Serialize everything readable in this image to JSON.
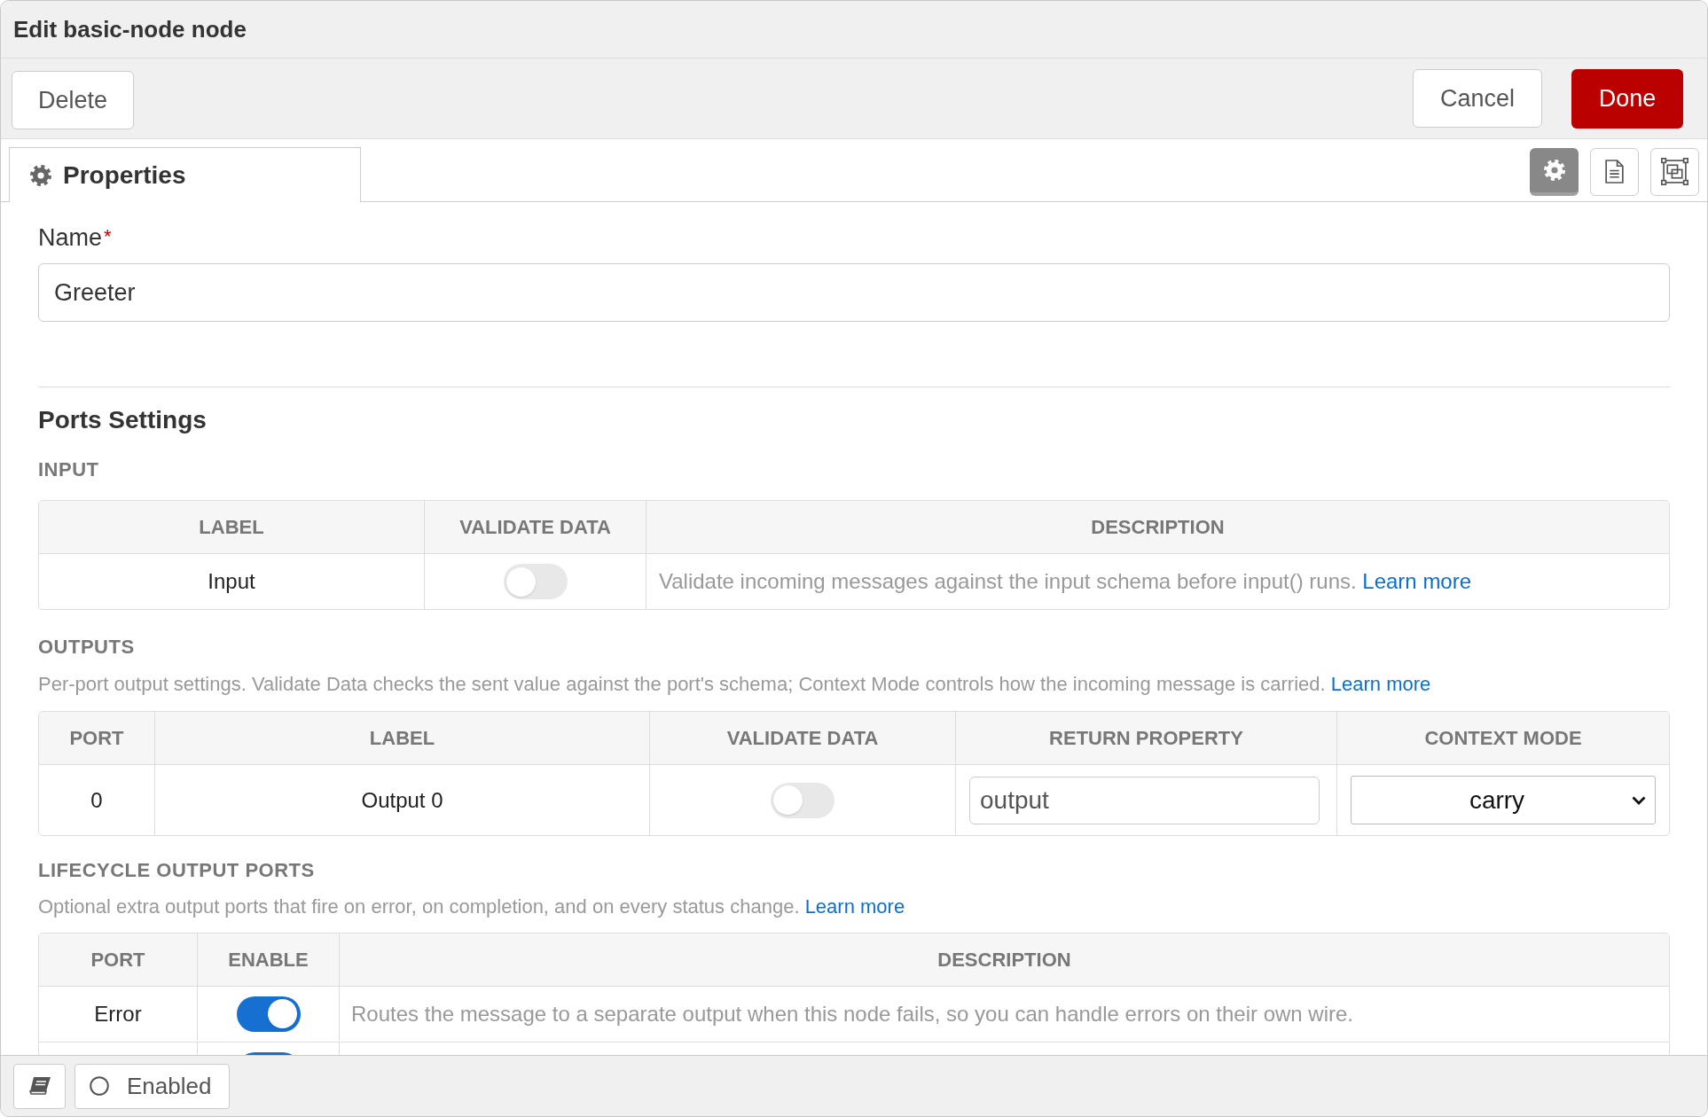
{
  "window": {
    "title": "Edit basic-node node"
  },
  "actions": {
    "delete": "Delete",
    "cancel": "Cancel",
    "done": "Done"
  },
  "tabs": [
    {
      "label": "Properties",
      "selected": true
    }
  ],
  "view_buttons": [
    {
      "selected": true
    },
    {
      "selected": false
    },
    {
      "selected": false
    }
  ],
  "name_field": {
    "label": "Name",
    "required_mark": "*",
    "value": "Greeter"
  },
  "ports_settings": {
    "title": "Ports Settings",
    "input": {
      "heading": "INPUT",
      "columns": [
        "LABEL",
        "VALIDATE DATA",
        "DESCRIPTION"
      ],
      "rows": [
        {
          "label": "Input",
          "validate": false,
          "description": "Validate incoming messages against the input schema before input() runs.",
          "link": "Learn more"
        }
      ]
    },
    "outputs": {
      "heading": "OUTPUTS",
      "help": "Per-port output settings. Validate Data checks the sent value against the port's schema; Context Mode controls how the incoming message is carried.",
      "link": "Learn more",
      "columns": [
        "PORT",
        "LABEL",
        "VALIDATE DATA",
        "RETURN PROPERTY",
        "CONTEXT MODE"
      ],
      "rows": [
        {
          "port": "0",
          "label": "Output 0",
          "validate": false,
          "return_property": "output",
          "context_mode": "carry"
        }
      ]
    },
    "lifecycle": {
      "heading": "LIFECYCLE OUTPUT PORTS",
      "help": "Optional extra output ports that fire on error, on completion, and on every status change.",
      "link": "Learn more",
      "columns": [
        "PORT",
        "ENABLE",
        "DESCRIPTION"
      ],
      "rows": [
        {
          "port": "Error",
          "enabled": true,
          "description": "Routes the message to a separate output when this node fails, so you can handle errors on their own wire."
        },
        {
          "enabled": true
        }
      ]
    }
  },
  "footer": {
    "enabled_label": "Enabled"
  }
}
